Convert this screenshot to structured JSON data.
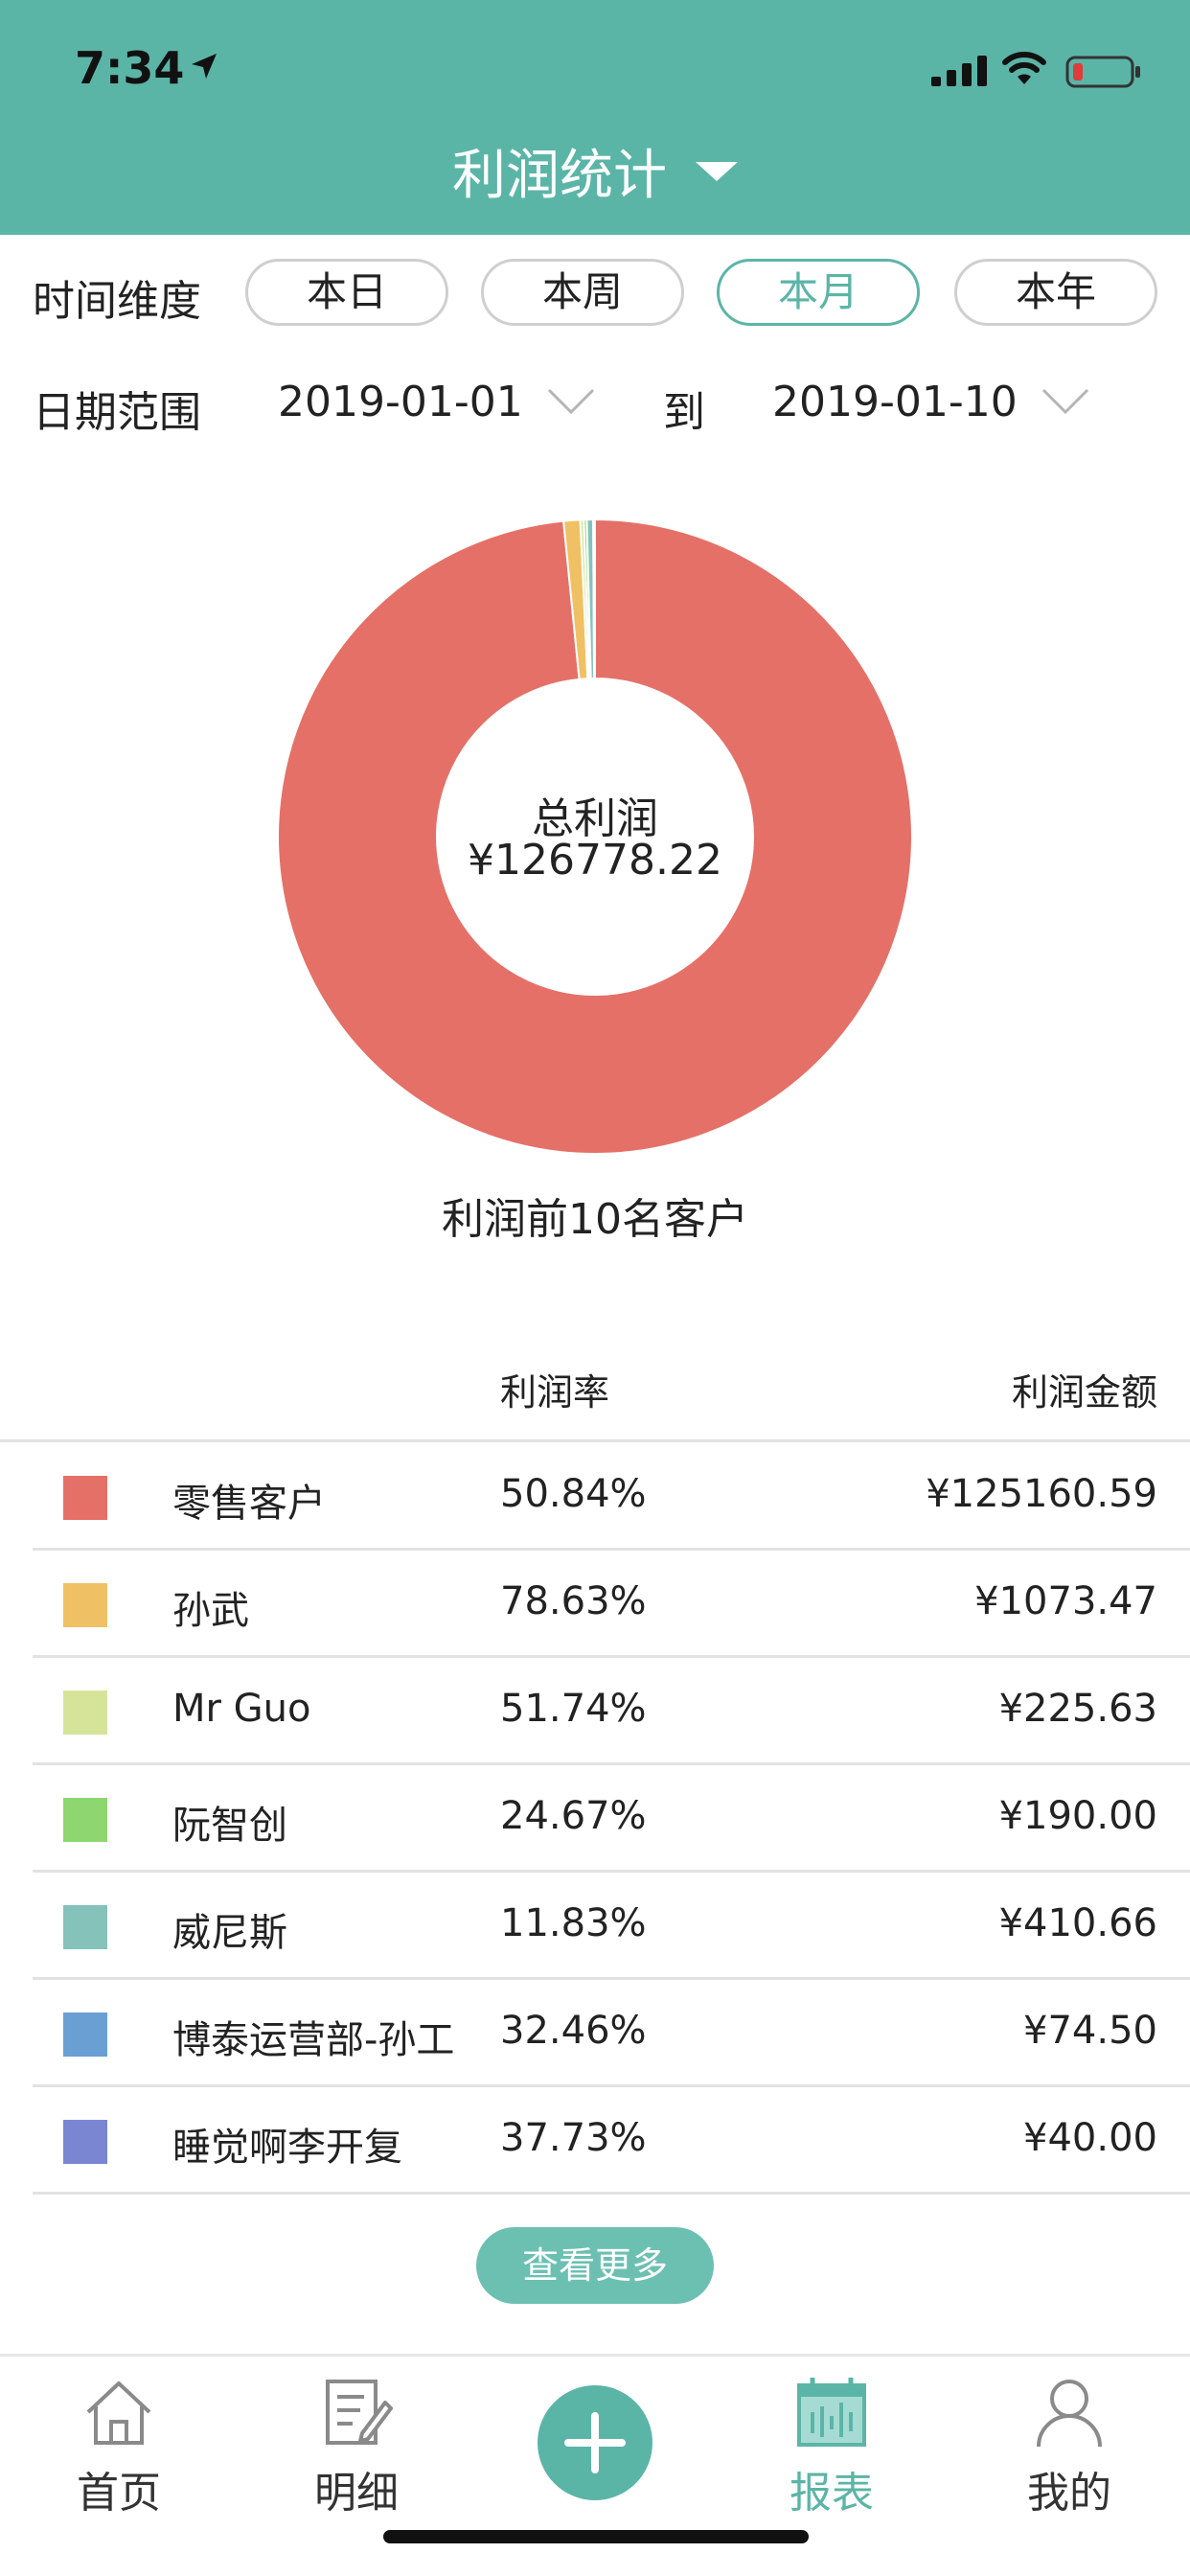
{
  "status_bar": {
    "time": "7:34"
  },
  "header": {
    "title": "利润统计"
  },
  "time_dimension": {
    "label": "时间维度",
    "options": [
      "本日",
      "本周",
      "本月",
      "本年"
    ],
    "selected": "本月"
  },
  "date_range": {
    "label": "日期范围",
    "start": "2019-01-01",
    "to_label": "到",
    "end": "2019-01-10"
  },
  "chart_data": {
    "type": "pie",
    "style": "donut",
    "center_label": "总利润",
    "center_value": "¥126778.22",
    "caption": "利润前10名客户",
    "slices": [
      {
        "name": "零售客户",
        "value": 125160.59,
        "color": "#e57067"
      },
      {
        "name": "孙武",
        "value": 1073.47,
        "color": "#f0c064"
      },
      {
        "name": "Mr Guo",
        "value": 225.63,
        "color": "#d6e49a"
      },
      {
        "name": "阮智创",
        "value": 190.0,
        "color": "#8ed66f"
      },
      {
        "name": "威尼斯",
        "value": 410.66,
        "color": "#84c2ba"
      },
      {
        "name": "博泰运营部-孙工",
        "value": 74.5,
        "color": "#6a9fd4"
      },
      {
        "name": "睡觉啊李开复",
        "value": 40.0,
        "color": "#7a86d2"
      }
    ]
  },
  "table": {
    "columns": {
      "rate": "利润率",
      "amount": "利润金额"
    },
    "rows": [
      {
        "name": "零售客户",
        "rate": "50.84%",
        "amount": "¥125160.59",
        "color": "#e57067"
      },
      {
        "name": "孙武",
        "rate": "78.63%",
        "amount": "¥1073.47",
        "color": "#f0c064"
      },
      {
        "name": "Mr Guo",
        "rate": "51.74%",
        "amount": "¥225.63",
        "color": "#d6e49a"
      },
      {
        "name": "阮智创",
        "rate": "24.67%",
        "amount": "¥190.00",
        "color": "#8ed66f"
      },
      {
        "name": "威尼斯",
        "rate": "11.83%",
        "amount": "¥410.66",
        "color": "#84c2ba"
      },
      {
        "name": "博泰运营部-孙工",
        "rate": "32.46%",
        "amount": "¥74.50",
        "color": "#6a9fd4"
      },
      {
        "name": "睡觉啊李开复",
        "rate": "37.73%",
        "amount": "¥40.00",
        "color": "#7a86d2"
      }
    ]
  },
  "more_button": "查看更多",
  "tabbar": {
    "items": [
      {
        "label": "首页",
        "icon": "home-icon"
      },
      {
        "label": "明细",
        "icon": "document-edit-icon"
      },
      {
        "label": "报表",
        "icon": "calendar-report-icon",
        "active": true
      },
      {
        "label": "我的",
        "icon": "user-icon"
      }
    ],
    "add_icon": "plus-icon"
  },
  "colors": {
    "accent": "#5bb5a7",
    "accent_light": "#6cc0b2"
  }
}
